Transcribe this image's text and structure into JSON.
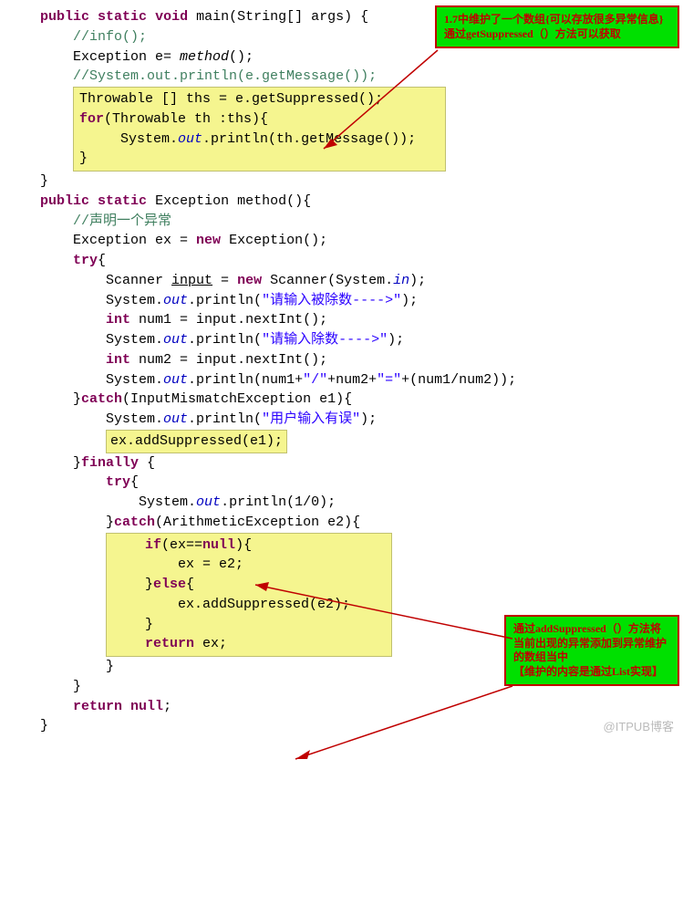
{
  "code": {
    "l1a": "public",
    "l1b": "static",
    "l1c": "void",
    "l1d": " main(String[] args) {",
    "l2": "",
    "l3": "//info();",
    "l4a": "        Exception e= ",
    "l4b": "method",
    "l4c": "();",
    "l5": "//System.out.println(e.getMessage());",
    "l6a": "Throwable [] ths = e.getSuppressed();",
    "l7a": "for",
    "l7b": "(Throwable th :ths){",
    "l8a": "     System.",
    "l8b": "out",
    "l8c": ".println(th.getMessage());",
    "l9": "}",
    "l10": "    }",
    "l11a": "public",
    "l11b": "static",
    "l11c": " Exception method(){",
    "l12": "//声明一个异常",
    "l13a": "        Exception ex = ",
    "l13b": "new",
    "l13c": " Exception();",
    "l14": "",
    "l15a": "try",
    "l15b": "{",
    "l16a": "            Scanner ",
    "l16b": "input",
    "l16c": " = ",
    "l16d": "new",
    "l16e": " Scanner(System.",
    "l16f": "in",
    "l16g": ");",
    "l17a": "            System.",
    "l17b": "out",
    "l17c": ".println(",
    "l17d": "\"请输入被除数---->\"",
    "l17e": ");",
    "l18a": "int",
    "l18b": " num1 = input.nextInt();",
    "l19a": "            System.",
    "l19b": "out",
    "l19c": ".println(",
    "l19d": "\"请输入除数---->\"",
    "l19e": ");",
    "l20a": "int",
    "l20b": " num2 = input.nextInt();",
    "l21a": "            System.",
    "l21b": "out",
    "l21c": ".println(num1+",
    "l21d": "\"/\"",
    "l21e": "+num2+",
    "l21f": "\"=\"",
    "l21g": "+(num1/num2));",
    "l22": "",
    "l23": "",
    "l24a": "        }",
    "l24b": "catch",
    "l24c": "(InputMismatchException e1){",
    "l25a": "            System.",
    "l25b": "out",
    "l25c": ".println(",
    "l25d": "\"用户输入有误\"",
    "l25e": ");",
    "l26": "ex.addSuppressed(e1);",
    "l27a": "        }",
    "l27b": "finally",
    "l27c": " {",
    "l28a": "try",
    "l28b": "{",
    "l29a": "                System.",
    "l29b": "out",
    "l29c": ".println(1/0);",
    "l30": "",
    "l31a": "            }",
    "l31b": "catch",
    "l31c": "(ArithmeticException e2){",
    "l32a": "if",
    "l32b": "(ex==",
    "l32c": "null",
    "l32d": "){",
    "l33": "        ex = e2;",
    "l34a": "    }",
    "l34b": "else",
    "l34c": "{",
    "l35": "        ex.addSuppressed(e2);",
    "l36": "    }",
    "l37a": "return",
    "l37b": " ex;",
    "l38": "            }",
    "l39": "        }",
    "l40a": "return",
    "l40b": "null",
    "l40c": ";",
    "l41": "",
    "l42": "    }"
  },
  "box1": {
    "line1": "1.7中维护了一个数组{可以存放很多异常信息}",
    "line2": "通过getSuppressed（）方法可以获取"
  },
  "box2": {
    "line1": "通过addSuppressed（）方法将当前出现的异常添加到异常维护的数组当中",
    "line2": "【维护的内容是通过List实现】"
  },
  "watermark": "@ITPUB博客"
}
